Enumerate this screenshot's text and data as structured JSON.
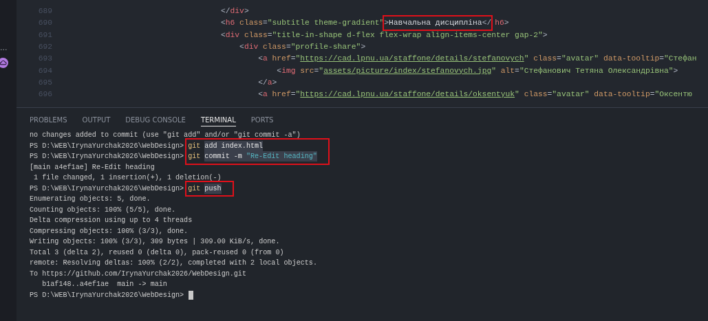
{
  "activity_bar": {
    "more": "..."
  },
  "editor": {
    "lines": [
      {
        "number": "689",
        "tokens": [
          {
            "kind": "punct",
            "text": "</"
          },
          {
            "kind": "tag",
            "text": "div"
          },
          {
            "kind": "punct",
            "text": ">"
          }
        ]
      },
      {
        "number": "690",
        "tokens": [
          {
            "kind": "punct",
            "text": "<"
          },
          {
            "kind": "tag",
            "text": "h6"
          },
          {
            "kind": "attr",
            "text": "class"
          },
          {
            "kind": "punct",
            "text": "="
          },
          {
            "kind": "string",
            "text": "\"subtitle theme-gradient\""
          },
          {
            "kind": "punct",
            "text": ">",
            "boxed": true
          },
          {
            "kind": "text",
            "text": "Навчальна дисципліна",
            "boxed": true
          },
          {
            "kind": "punct",
            "text": "</",
            "boxed": true
          },
          {
            "kind": "tag",
            "text": "h6"
          },
          {
            "kind": "punct",
            "text": ">"
          }
        ]
      },
      {
        "number": "691",
        "tokens": [
          {
            "kind": "punct",
            "text": "<"
          },
          {
            "kind": "tag",
            "text": "div"
          },
          {
            "kind": "attr",
            "text": "class"
          },
          {
            "kind": "punct",
            "text": "="
          },
          {
            "kind": "string",
            "text": "\"title-in-shape d-flex flex-wrap align-items-center gap-2\""
          },
          {
            "kind": "punct",
            "text": ">"
          }
        ],
        "children": [
          {
            "number": "692",
            "tokens": [
              {
                "kind": "punct",
                "text": "<"
              },
              {
                "kind": "tag",
                "text": "div"
              },
              {
                "kind": "attr",
                "text": "class"
              },
              {
                "kind": "punct",
                "text": "="
              },
              {
                "kind": "string",
                "text": "\"profile-share\""
              },
              {
                "kind": "punct",
                "text": ">"
              }
            ],
            "children": [
              {
                "number": "693",
                "tokens": [
                  {
                    "kind": "punct",
                    "text": "<"
                  },
                  {
                    "kind": "tag",
                    "text": "a"
                  },
                  {
                    "kind": "attr",
                    "text": "href"
                  },
                  {
                    "kind": "punct",
                    "text": "="
                  },
                  {
                    "kind": "string",
                    "text": "\""
                  },
                  {
                    "kind": "link",
                    "text": "https://cad.lpnu.ua/staffone/details/stefanovych"
                  },
                  {
                    "kind": "string",
                    "text": "\""
                  },
                  {
                    "kind": "attr",
                    "text": "class"
                  },
                  {
                    "kind": "punct",
                    "text": "="
                  },
                  {
                    "kind": "string",
                    "text": "\"avatar\""
                  },
                  {
                    "kind": "attr",
                    "text": "data-tooltip"
                  },
                  {
                    "kind": "punct",
                    "text": "="
                  },
                  {
                    "kind": "string",
                    "text": "\"Стефан"
                  }
                ],
                "children": [
                  {
                    "number": "694",
                    "tokens": [
                      {
                        "kind": "punct",
                        "text": "<"
                      },
                      {
                        "kind": "tag",
                        "text": "img"
                      },
                      {
                        "kind": "attr",
                        "text": "src"
                      },
                      {
                        "kind": "punct",
                        "text": "="
                      },
                      {
                        "kind": "string",
                        "text": "\""
                      },
                      {
                        "kind": "link",
                        "text": "assets/picture/index/stefanovych.jpg"
                      },
                      {
                        "kind": "string",
                        "text": "\""
                      },
                      {
                        "kind": "attr",
                        "text": "alt"
                      },
                      {
                        "kind": "punct",
                        "text": "="
                      },
                      {
                        "kind": "string",
                        "text": "\"Стефанович Тетяна Олександрівна\""
                      },
                      {
                        "kind": "punct",
                        "text": ">"
                      }
                    ]
                  }
                ]
              },
              {
                "number": "695",
                "tokens": [
                  {
                    "kind": "punct",
                    "text": "</"
                  },
                  {
                    "kind": "tag",
                    "text": "a"
                  },
                  {
                    "kind": "punct",
                    "text": ">"
                  }
                ]
              },
              {
                "number": "696",
                "tokens": [
                  {
                    "kind": "punct",
                    "text": "<"
                  },
                  {
                    "kind": "tag",
                    "text": "a"
                  },
                  {
                    "kind": "attr",
                    "text": "href"
                  },
                  {
                    "kind": "punct",
                    "text": "="
                  },
                  {
                    "kind": "string",
                    "text": "\""
                  },
                  {
                    "kind": "link",
                    "text": "https://cad.lpnu.ua/staffone/details/oksentyuk"
                  },
                  {
                    "kind": "string",
                    "text": "\""
                  },
                  {
                    "kind": "attr",
                    "text": "class"
                  },
                  {
                    "kind": "punct",
                    "text": "="
                  },
                  {
                    "kind": "string",
                    "text": "\"avatar\""
                  },
                  {
                    "kind": "attr",
                    "text": "data-tooltip"
                  },
                  {
                    "kind": "punct",
                    "text": "="
                  },
                  {
                    "kind": "string",
                    "text": "\"Оксентю"
                  }
                ]
              }
            ]
          }
        ]
      }
    ]
  },
  "panel": {
    "tabs": [
      {
        "label": "PROBLEMS",
        "selected": false
      },
      {
        "label": "OUTPUT",
        "selected": false
      },
      {
        "label": "DEBUG CONSOLE",
        "selected": false
      },
      {
        "label": "TERMINAL",
        "selected": true
      },
      {
        "label": "PORTS",
        "selected": false
      }
    ]
  },
  "terminal": {
    "entries": [
      {
        "kind": "output",
        "text": "no changes added to commit (use \"git add\" and/or \"git commit -a\")"
      },
      {
        "kind": "commands",
        "boxed": true,
        "commands": [
          {
            "prompt": "PS D:\\WEB\\IrynaYurchak2026\\WebDesign>",
            "tokens": [
              {
                "kind": "program",
                "text": "git"
              },
              {
                "kind": "arg",
                "text": "add index.html"
              }
            ]
          },
          {
            "prompt": "PS D:\\WEB\\IrynaYurchak2026\\WebDesign>",
            "tokens": [
              {
                "kind": "program",
                "text": "git"
              },
              {
                "kind": "arg",
                "text": "commit -m"
              },
              {
                "kind": "string",
                "text": "\"Re-Edit heading\""
              }
            ]
          }
        ]
      },
      {
        "kind": "output",
        "text": "[main a4ef1ae] Re-Edit heading"
      },
      {
        "kind": "output",
        "text": " 1 file changed, 1 insertion(+), 1 deletion(-)"
      },
      {
        "kind": "commands",
        "boxed": true,
        "commands": [
          {
            "prompt": "PS D:\\WEB\\IrynaYurchak2026\\WebDesign>",
            "tokens": [
              {
                "kind": "program",
                "text": "git"
              },
              {
                "kind": "arg",
                "text": "push"
              }
            ]
          }
        ]
      },
      {
        "kind": "output",
        "text": "Enumerating objects: 5, done."
      },
      {
        "kind": "output",
        "text": "Counting objects: 100% (5/5), done."
      },
      {
        "kind": "output",
        "text": "Delta compression using up to 4 threads"
      },
      {
        "kind": "output",
        "text": "Compressing objects: 100% (3/3), done."
      },
      {
        "kind": "output",
        "text": "Writing objects: 100% (3/3), 309 bytes | 309.00 KiB/s, done."
      },
      {
        "kind": "output",
        "text": "Total 3 (delta 2), reused 0 (delta 0), pack-reused 0 (from 0)"
      },
      {
        "kind": "output",
        "text": "remote: Resolving deltas: 100% (2/2), completed with 2 local objects."
      },
      {
        "kind": "output",
        "text": "To https://github.com/IrynaYurchak2026/WebDesign.git"
      },
      {
        "kind": "output",
        "text": "   b1af148..a4ef1ae  main -> main"
      },
      {
        "kind": "prompt",
        "prompt": "PS D:\\WEB\\IrynaYurchak2026\\WebDesign>",
        "cursor": true
      }
    ]
  }
}
